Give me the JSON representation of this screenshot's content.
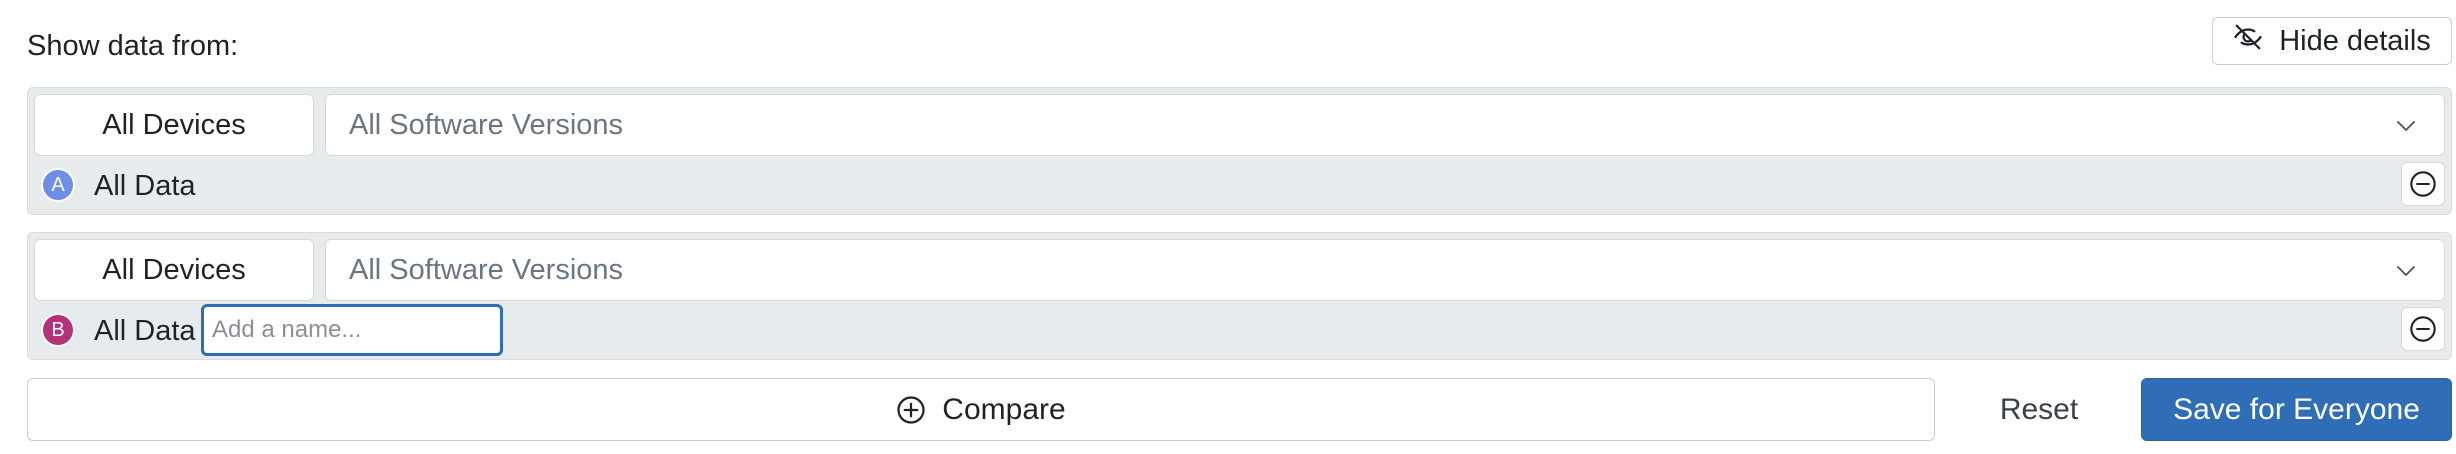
{
  "header": {
    "label": "Show data from:",
    "hide_details_label": "Hide details",
    "hide_details_icon": "eye-off-icon"
  },
  "series": [
    {
      "badge": "A",
      "badge_color": "#6f8fe6",
      "device_label": "All Devices",
      "version_label": "All Software Versions",
      "label": "All Data"
    },
    {
      "badge": "B",
      "badge_color": "#b5317a",
      "device_label": "All Devices",
      "version_label": "All Software Versions",
      "label": "All Data",
      "name_placeholder": "Add a name..."
    }
  ],
  "footer": {
    "compare_label": "Compare",
    "reset_label": "Reset",
    "save_label": "Save for Everyone"
  },
  "colors": {
    "accent": "#2f6db6",
    "row_bg": "#e8ebed"
  }
}
